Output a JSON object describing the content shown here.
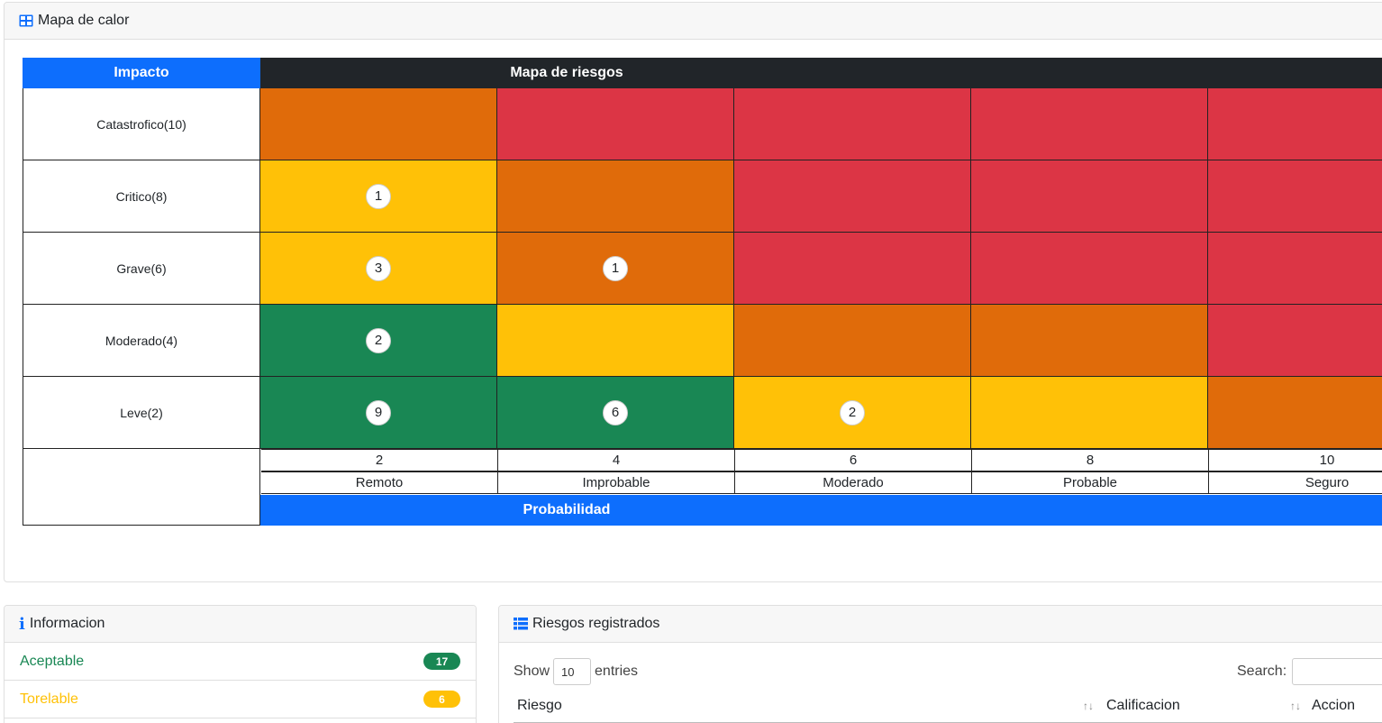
{
  "heat_card": {
    "title": "Mapa de calor",
    "impact_header": "Impacto",
    "map_header": "Mapa de riesgos",
    "probability_header": "Probabilidad",
    "impact_rows": [
      "Catastrofico(10)",
      "Critico(8)",
      "Grave(6)",
      "Moderado(4)",
      "Leve(2)"
    ],
    "probability_values": [
      "2",
      "4",
      "6",
      "8",
      "10"
    ],
    "probability_labels": [
      "Remoto",
      "Improbable",
      "Moderado",
      "Probable",
      "Seguro"
    ],
    "grid_colors": [
      [
        "orange",
        "red",
        "red",
        "red",
        "red"
      ],
      [
        "yellow",
        "orange",
        "red",
        "red",
        "red"
      ],
      [
        "yellow",
        "orange",
        "red",
        "red",
        "red"
      ],
      [
        "green",
        "yellow",
        "orange",
        "orange",
        "red"
      ],
      [
        "green",
        "green",
        "yellow",
        "yellow",
        "orange"
      ]
    ],
    "grid_counts": [
      [
        "",
        "",
        "",
        "",
        ""
      ],
      [
        "1",
        "",
        "",
        "",
        ""
      ],
      [
        "3",
        "1",
        "",
        "",
        ""
      ],
      [
        "2",
        "",
        "",
        "",
        ""
      ],
      [
        "9",
        "6",
        "2",
        "",
        ""
      ]
    ]
  },
  "info_card": {
    "title": "Informacion",
    "items": [
      {
        "label": "Aceptable",
        "count": "17",
        "color": "#198754"
      },
      {
        "label": "Torelable",
        "count": "6",
        "color": "#ffc107"
      }
    ]
  },
  "riesgos_card": {
    "title": "Riesgos registrados",
    "show_label": "Show",
    "show_value": "10",
    "entries_label": "entries",
    "search_label": "Search:",
    "columns": [
      "Riesgo",
      "Calificacion",
      "Accion"
    ]
  },
  "colors": {
    "green": "#198754",
    "yellow": "#ffc107",
    "orange": "#e06b0a",
    "red": "#dc3545",
    "primary": "#0d6efd",
    "dark": "#212529"
  }
}
